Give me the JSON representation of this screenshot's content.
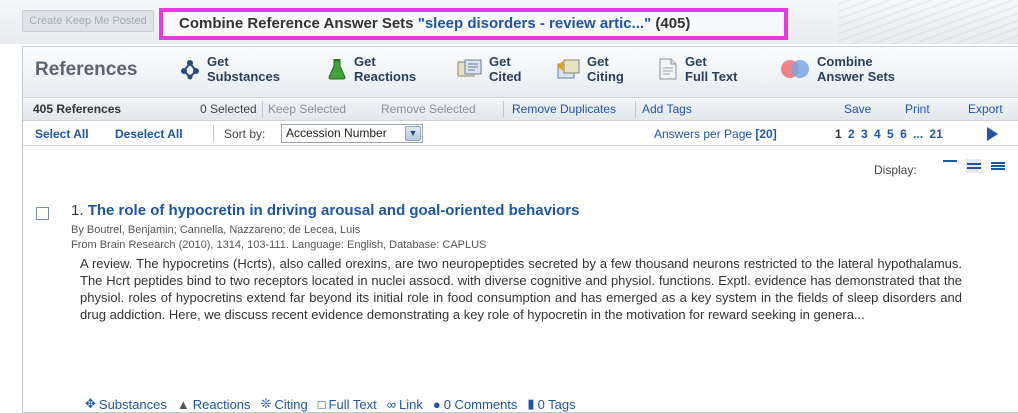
{
  "topbar": {
    "create_button": "Create Keep Me Posted",
    "title_prefix": "Combine Reference Answer Sets ",
    "title_query": "\"sleep disorders - review artic...\"",
    "title_count": " (405)"
  },
  "toolbar": {
    "title": "References",
    "buttons": [
      {
        "line1": "Get",
        "line2": "Substances",
        "icon": "substances-icon"
      },
      {
        "line1": "Get",
        "line2": "Reactions",
        "icon": "flask-icon"
      },
      {
        "line1": "Get",
        "line2": "Cited",
        "icon": "cited-icon"
      },
      {
        "line1": "Get",
        "line2": "Citing",
        "icon": "citing-icon"
      },
      {
        "line1": "Get",
        "line2": "Full Text",
        "icon": "document-icon"
      },
      {
        "line1": "Combine",
        "line2": "Answer Sets",
        "icon": "venn-icon"
      }
    ]
  },
  "actionbar": {
    "count": "405 References",
    "selected": "0 Selected",
    "keep_selected": "Keep Selected",
    "remove_selected": "Remove Selected",
    "remove_duplicates": "Remove Duplicates",
    "add_tags": "Add Tags",
    "save": "Save",
    "print": "Print",
    "export": "Export"
  },
  "sortbar": {
    "select_all": "Select All",
    "deselect_all": "Deselect All",
    "sort_by_label": "Sort by:",
    "sort_value": "Accession Number",
    "answers_per_page_label": "Answers per Page ",
    "answers_per_page_value": "[20]",
    "pages": {
      "current": "1",
      "others": "2 3 4 5 6 ... 21"
    }
  },
  "display": {
    "label": "Display:"
  },
  "result": {
    "number": "1.",
    "title": "The role of hypocretin in driving arousal and goal-oriented behaviors",
    "authors": "By Boutrel, Benjamin; Cannella, Nazzareno; de Lecea, Luis",
    "source": "From Brain Research (2010), 1314, 103-111. Language: English, Database: CAPLUS",
    "abstract": "A review.  The hypocretins (Hcrts), also called orexins, are two neuropeptides secreted by a few thousand neurons restricted to the lateral hypothalamus.  The Hcrt peptides bind to two receptors located in nuclei assocd. with diverse cognitive and physiol. functions.  Exptl. evidence has demonstrated that the physiol. roles of hypocretins extend far beyond its initial role in food consumption and has emerged as a key system in the fields of sleep disorders and drug addiction.  Here, we discuss recent evidence demonstrating a key role of hypocretin in the motivation for reward seeking in genera...",
    "links": {
      "substances": "Substances",
      "reactions": "Reactions",
      "citing": "Citing",
      "full_text": "Full Text",
      "link": "Link",
      "comments": "0 Comments",
      "tags": "0 Tags"
    }
  },
  "colors": {
    "accent": "#1e55a8",
    "highlight_border": "#e838e0"
  }
}
